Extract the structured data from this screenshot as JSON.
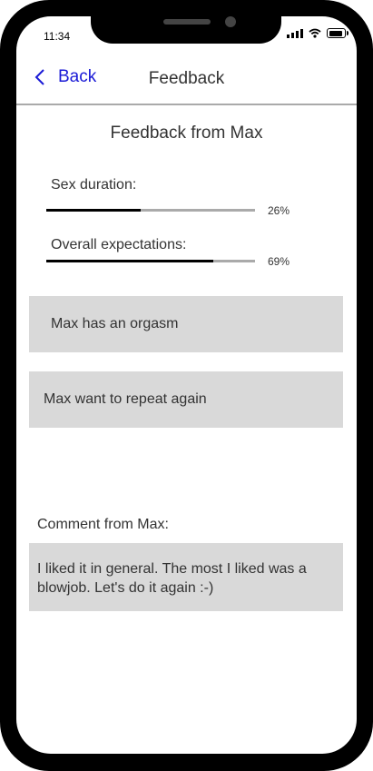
{
  "status_bar": {
    "time": "11:34"
  },
  "nav": {
    "back_label": "Back",
    "title": "Feedback"
  },
  "feedback": {
    "title": "Feedback from Max",
    "metrics": [
      {
        "label": "Sex duration:",
        "percent_text": "26%",
        "value": 0.45
      },
      {
        "label": "Overall expectations:",
        "percent_text": "69%",
        "value": 0.8
      }
    ],
    "statements": [
      "Max has an orgasm",
      "Max want to repeat again"
    ],
    "comment_label": "Comment from Max:",
    "comment_text": "I liked it in general. The most I liked was a blowjob. Let's do it again :-)"
  },
  "colors": {
    "accent": "#1a1ad6",
    "box": "#d9d9d9",
    "divider": "#aaaaaa"
  }
}
